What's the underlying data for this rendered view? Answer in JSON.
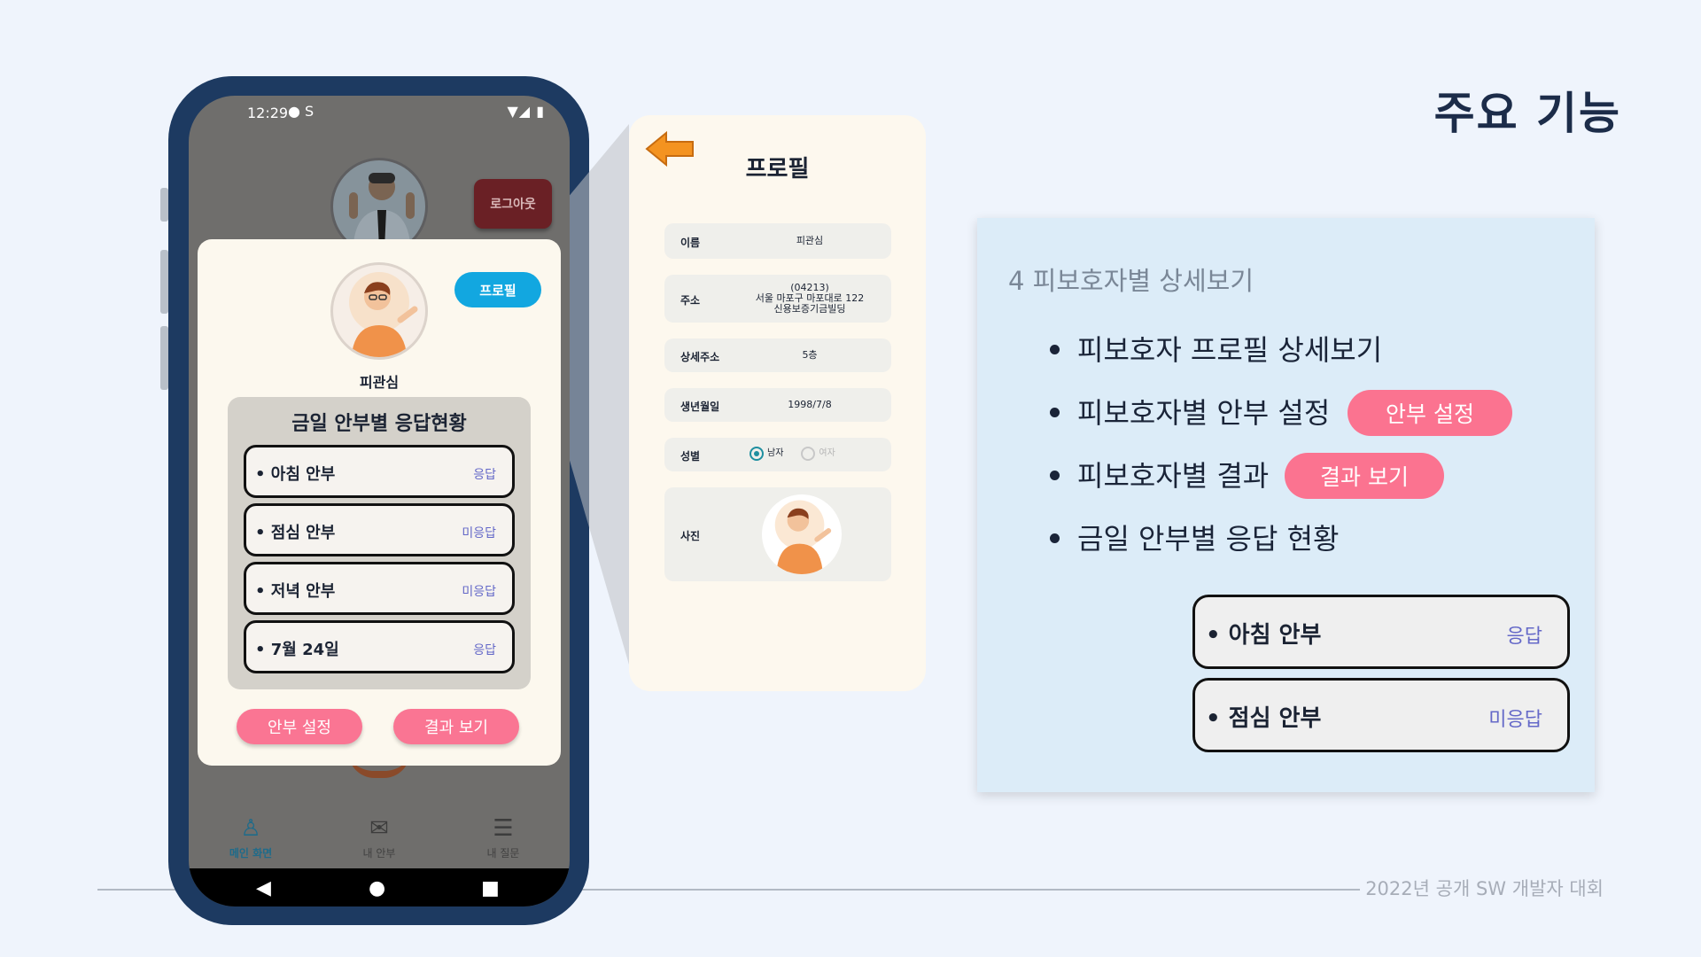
{
  "slide": {
    "title": "주요 기능",
    "footer": "2022년 공개 SW 개발자 대회"
  },
  "phone": {
    "status_time": "12:29",
    "status_icons": "● S",
    "status_right": "▼◢ ▮",
    "logout_label": "로그아웃",
    "profile_button": "프로필",
    "person_name": "피관심",
    "panel_title": "금일 안부별 응답현황",
    "rows": [
      {
        "label": "아침 안부",
        "status": "응답"
      },
      {
        "label": "점심 안부",
        "status": "미응답"
      },
      {
        "label": "저녁 안부",
        "status": "미응답"
      },
      {
        "label": "7월 24일",
        "status": "응답"
      }
    ],
    "safety_button": "안부 설정",
    "result_button": "결과 보기",
    "nav": [
      {
        "label": "메인 화면",
        "icon": "person-icon"
      },
      {
        "label": "내 안부",
        "icon": "mail-icon"
      },
      {
        "label": "내 질문",
        "icon": "clipboard-icon"
      }
    ],
    "sys_nav": {
      "back": "◀",
      "home": "●",
      "recent": "■"
    }
  },
  "profile_screen": {
    "title": "프로필",
    "fields": [
      {
        "label": "이름",
        "value": "피관심"
      },
      {
        "label": "주소",
        "value_lines": [
          "(04213)",
          "서울 마포구 마포대로 122",
          "신용보증기금빌딩"
        ]
      },
      {
        "label": "상세주소",
        "value": "5층"
      },
      {
        "label": "생년월일",
        "value": "1998/7/8"
      },
      {
        "label": "성별",
        "options": [
          "남자",
          "여자"
        ],
        "selected": "남자"
      },
      {
        "label": "사진"
      }
    ]
  },
  "card": {
    "heading": "4 피보호자별 상세보기",
    "bullets": [
      "피보호자 프로필 상세보기",
      "피보호자별 안부 설정",
      "피보호자별 결과",
      "금일 안부별 응답 현황"
    ],
    "safety_pill": "안부 설정",
    "result_pill": "결과 보기",
    "rows": [
      {
        "label": "아침 안부",
        "status": "응답"
      },
      {
        "label": "점심 안부",
        "status": "미응답"
      }
    ]
  },
  "colors": {
    "accent_pink": "#fb7390",
    "profile_blue": "#12a7e0",
    "status_text": "#6468c8",
    "phone_frame": "#1d3a61"
  }
}
